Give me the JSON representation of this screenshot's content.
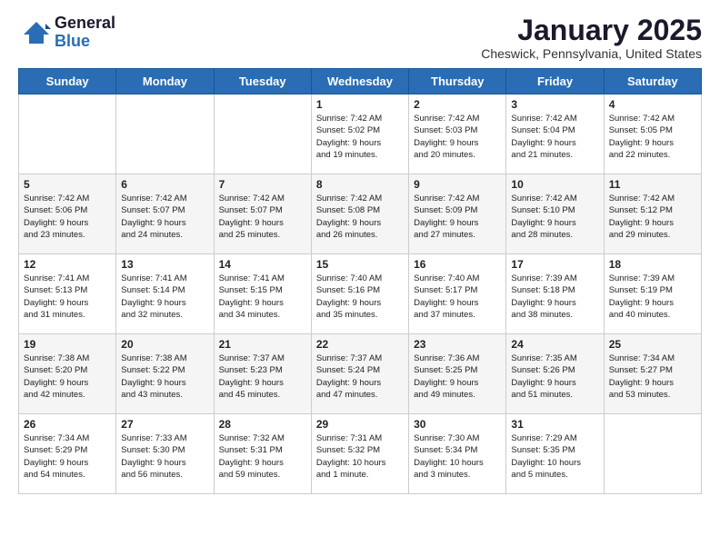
{
  "header": {
    "logo_line1": "General",
    "logo_line2": "Blue",
    "month": "January 2025",
    "location": "Cheswick, Pennsylvania, United States"
  },
  "weekdays": [
    "Sunday",
    "Monday",
    "Tuesday",
    "Wednesday",
    "Thursday",
    "Friday",
    "Saturday"
  ],
  "weeks": [
    [
      {
        "day": "",
        "info": ""
      },
      {
        "day": "",
        "info": ""
      },
      {
        "day": "",
        "info": ""
      },
      {
        "day": "1",
        "info": "Sunrise: 7:42 AM\nSunset: 5:02 PM\nDaylight: 9 hours\nand 19 minutes."
      },
      {
        "day": "2",
        "info": "Sunrise: 7:42 AM\nSunset: 5:03 PM\nDaylight: 9 hours\nand 20 minutes."
      },
      {
        "day": "3",
        "info": "Sunrise: 7:42 AM\nSunset: 5:04 PM\nDaylight: 9 hours\nand 21 minutes."
      },
      {
        "day": "4",
        "info": "Sunrise: 7:42 AM\nSunset: 5:05 PM\nDaylight: 9 hours\nand 22 minutes."
      }
    ],
    [
      {
        "day": "5",
        "info": "Sunrise: 7:42 AM\nSunset: 5:06 PM\nDaylight: 9 hours\nand 23 minutes."
      },
      {
        "day": "6",
        "info": "Sunrise: 7:42 AM\nSunset: 5:07 PM\nDaylight: 9 hours\nand 24 minutes."
      },
      {
        "day": "7",
        "info": "Sunrise: 7:42 AM\nSunset: 5:07 PM\nDaylight: 9 hours\nand 25 minutes."
      },
      {
        "day": "8",
        "info": "Sunrise: 7:42 AM\nSunset: 5:08 PM\nDaylight: 9 hours\nand 26 minutes."
      },
      {
        "day": "9",
        "info": "Sunrise: 7:42 AM\nSunset: 5:09 PM\nDaylight: 9 hours\nand 27 minutes."
      },
      {
        "day": "10",
        "info": "Sunrise: 7:42 AM\nSunset: 5:10 PM\nDaylight: 9 hours\nand 28 minutes."
      },
      {
        "day": "11",
        "info": "Sunrise: 7:42 AM\nSunset: 5:12 PM\nDaylight: 9 hours\nand 29 minutes."
      }
    ],
    [
      {
        "day": "12",
        "info": "Sunrise: 7:41 AM\nSunset: 5:13 PM\nDaylight: 9 hours\nand 31 minutes."
      },
      {
        "day": "13",
        "info": "Sunrise: 7:41 AM\nSunset: 5:14 PM\nDaylight: 9 hours\nand 32 minutes."
      },
      {
        "day": "14",
        "info": "Sunrise: 7:41 AM\nSunset: 5:15 PM\nDaylight: 9 hours\nand 34 minutes."
      },
      {
        "day": "15",
        "info": "Sunrise: 7:40 AM\nSunset: 5:16 PM\nDaylight: 9 hours\nand 35 minutes."
      },
      {
        "day": "16",
        "info": "Sunrise: 7:40 AM\nSunset: 5:17 PM\nDaylight: 9 hours\nand 37 minutes."
      },
      {
        "day": "17",
        "info": "Sunrise: 7:39 AM\nSunset: 5:18 PM\nDaylight: 9 hours\nand 38 minutes."
      },
      {
        "day": "18",
        "info": "Sunrise: 7:39 AM\nSunset: 5:19 PM\nDaylight: 9 hours\nand 40 minutes."
      }
    ],
    [
      {
        "day": "19",
        "info": "Sunrise: 7:38 AM\nSunset: 5:20 PM\nDaylight: 9 hours\nand 42 minutes."
      },
      {
        "day": "20",
        "info": "Sunrise: 7:38 AM\nSunset: 5:22 PM\nDaylight: 9 hours\nand 43 minutes."
      },
      {
        "day": "21",
        "info": "Sunrise: 7:37 AM\nSunset: 5:23 PM\nDaylight: 9 hours\nand 45 minutes."
      },
      {
        "day": "22",
        "info": "Sunrise: 7:37 AM\nSunset: 5:24 PM\nDaylight: 9 hours\nand 47 minutes."
      },
      {
        "day": "23",
        "info": "Sunrise: 7:36 AM\nSunset: 5:25 PM\nDaylight: 9 hours\nand 49 minutes."
      },
      {
        "day": "24",
        "info": "Sunrise: 7:35 AM\nSunset: 5:26 PM\nDaylight: 9 hours\nand 51 minutes."
      },
      {
        "day": "25",
        "info": "Sunrise: 7:34 AM\nSunset: 5:27 PM\nDaylight: 9 hours\nand 53 minutes."
      }
    ],
    [
      {
        "day": "26",
        "info": "Sunrise: 7:34 AM\nSunset: 5:29 PM\nDaylight: 9 hours\nand 54 minutes."
      },
      {
        "day": "27",
        "info": "Sunrise: 7:33 AM\nSunset: 5:30 PM\nDaylight: 9 hours\nand 56 minutes."
      },
      {
        "day": "28",
        "info": "Sunrise: 7:32 AM\nSunset: 5:31 PM\nDaylight: 9 hours\nand 59 minutes."
      },
      {
        "day": "29",
        "info": "Sunrise: 7:31 AM\nSunset: 5:32 PM\nDaylight: 10 hours\nand 1 minute."
      },
      {
        "day": "30",
        "info": "Sunrise: 7:30 AM\nSunset: 5:34 PM\nDaylight: 10 hours\nand 3 minutes."
      },
      {
        "day": "31",
        "info": "Sunrise: 7:29 AM\nSunset: 5:35 PM\nDaylight: 10 hours\nand 5 minutes."
      },
      {
        "day": "",
        "info": ""
      }
    ]
  ]
}
